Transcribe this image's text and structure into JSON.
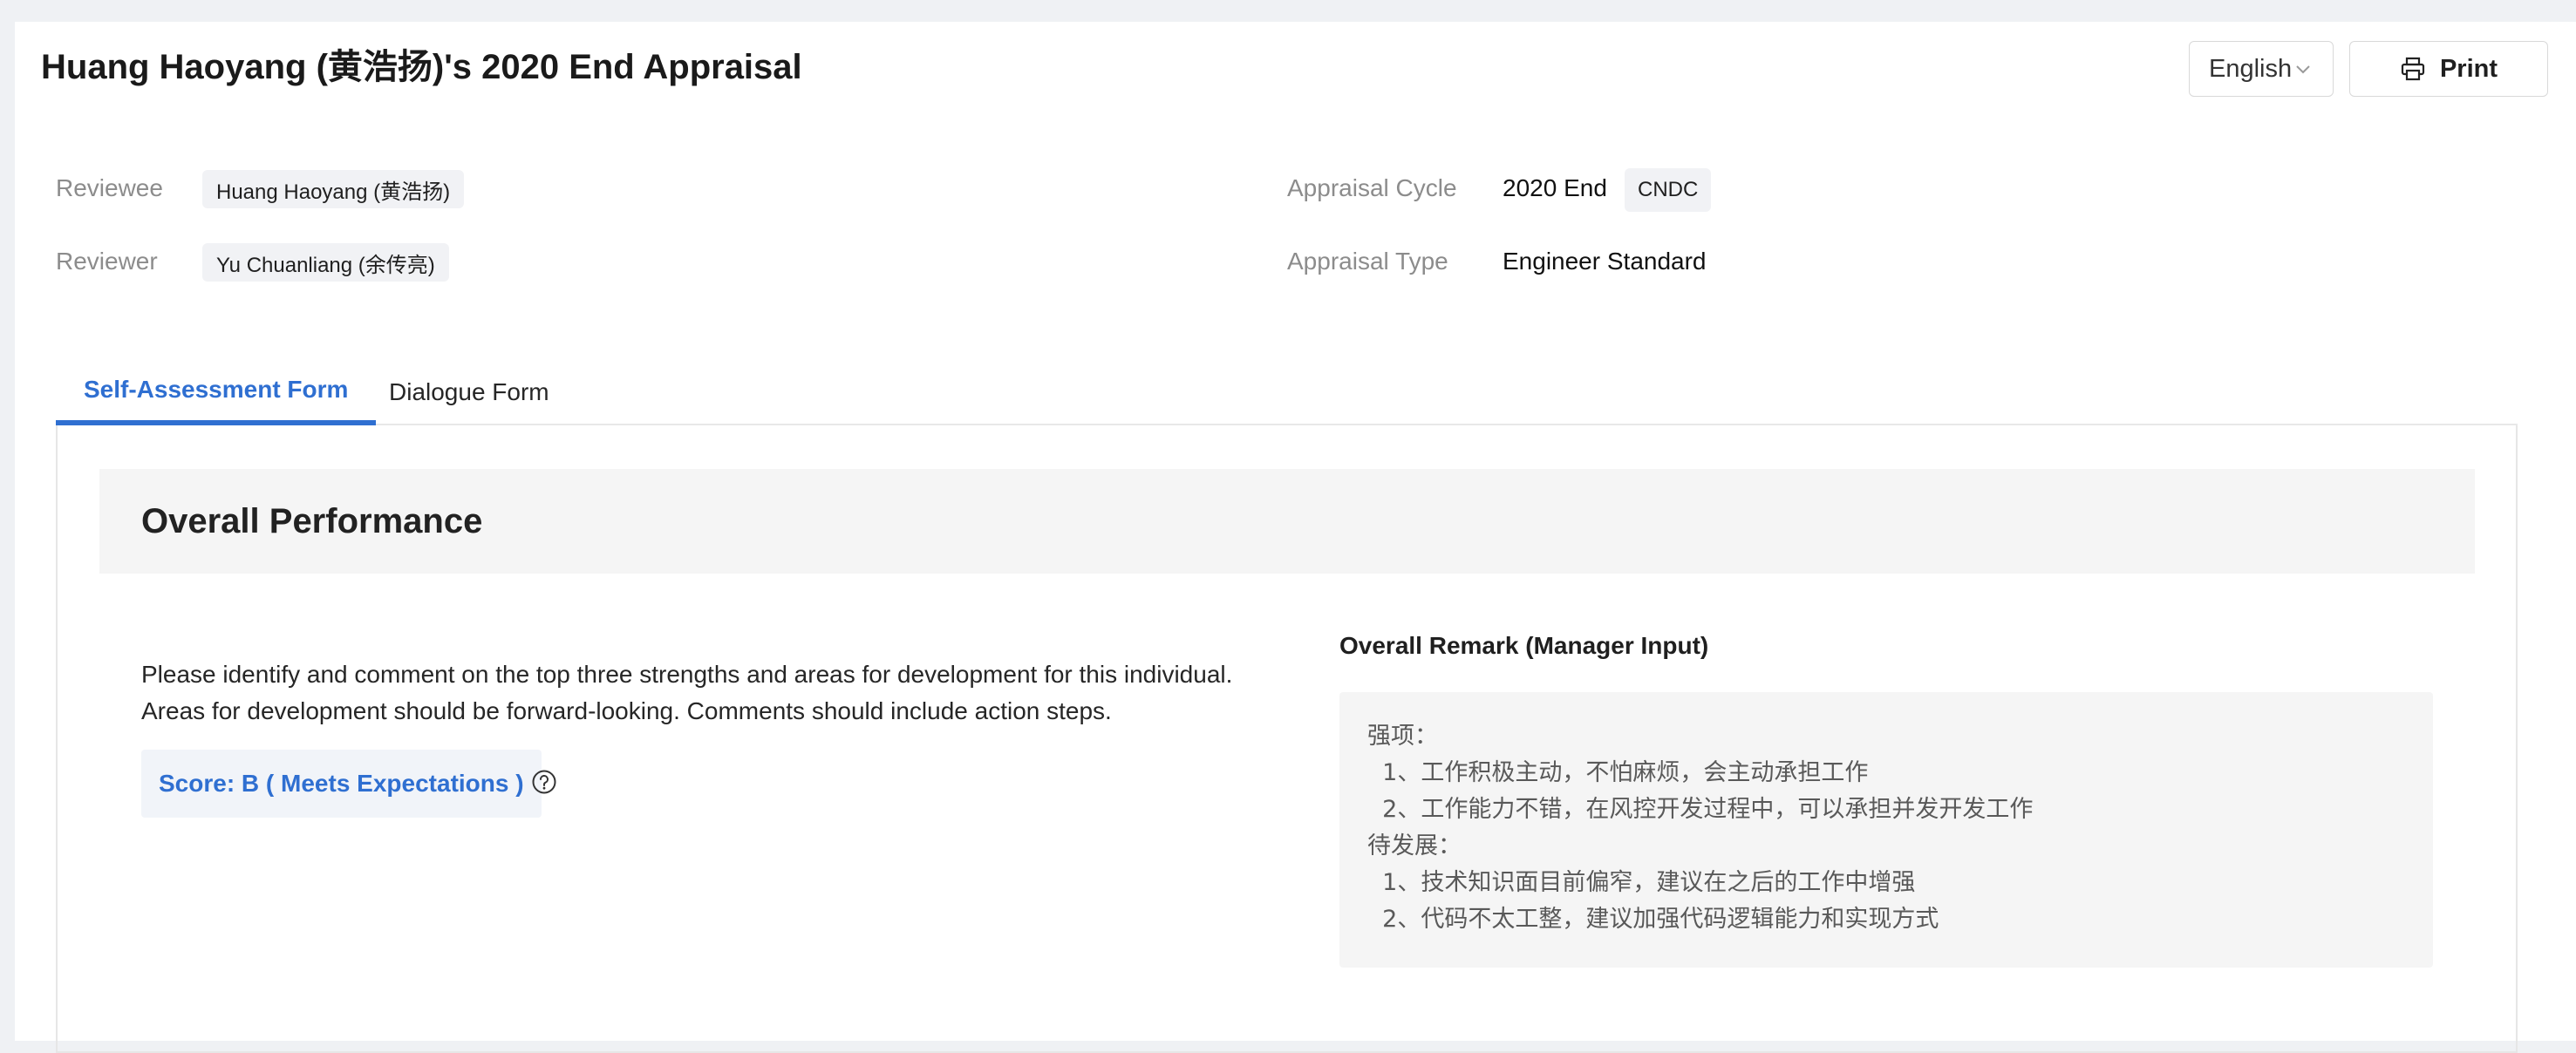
{
  "header": {
    "title": "Huang Haoyang (黄浩扬)'s 2020 End Appraisal",
    "language_select": {
      "value": "English"
    },
    "print_label": "Print"
  },
  "meta": {
    "reviewee_label": "Reviewee",
    "reviewee_value": "Huang Haoyang (黄浩扬)",
    "reviewer_label": "Reviewer",
    "reviewer_value": "Yu Chuanliang (余传亮)",
    "cycle_label": "Appraisal Cycle",
    "cycle_value": "2020 End",
    "cycle_tag": "CNDC",
    "type_label": "Appraisal Type",
    "type_value": "Engineer Standard"
  },
  "tabs": [
    {
      "label": "Self-Assessment Form",
      "active": true
    },
    {
      "label": "Dialogue Form",
      "active": false
    }
  ],
  "section": {
    "title": "Overall Performance",
    "instructions": "Please identify and comment on the top three strengths and areas for development for this individual. Areas for development should be forward-looking. Comments should include action steps.",
    "score_label": "Score: B ( Meets Expectations )",
    "remark_title": "Overall Remark (Manager Input)",
    "remark_lines": [
      "强项：",
      "  1、工作积极主动，不怕麻烦，会主动承担工作",
      "  2、工作能力不错，在风控开发过程中，可以承担并发开发工作",
      "待发展：",
      "  1、技术知识面目前偏窄，建议在之后的工作中增强",
      "  2、代码不太工整，建议加强代码逻辑能力和实现方式"
    ]
  },
  "colors": {
    "accent": "#2f6fd1",
    "page_bg": "#eff1f4",
    "tag_bg": "#f1f2f5",
    "muted_text": "#8c8c8c"
  },
  "icons": {
    "language_chevron": "chevron-down-icon",
    "print": "printer-icon",
    "help": "question-circle-icon"
  }
}
